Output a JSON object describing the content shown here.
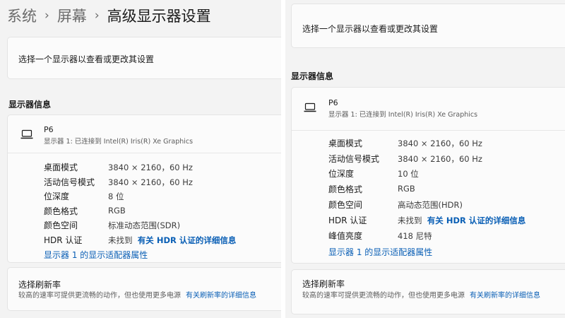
{
  "left_panel": {
    "breadcrumb": {
      "item1": "系统",
      "item2": "屏幕",
      "current": "高级显示器设置",
      "separator": "›"
    },
    "select_display": {
      "text": "选择一个显示器以查看或更改其设置"
    },
    "section_title": "显示器信息",
    "monitor": {
      "name": "P6",
      "subtitle": "显示器 1: 已连接到 Intel(R) Iris(R) Xe Graphics",
      "icon": "laptop-icon"
    },
    "properties": [
      {
        "label": "桌面模式",
        "value": "3840 × 2160，60 Hz"
      },
      {
        "label": "活动信号模式",
        "value": "3840 × 2160，60 Hz"
      },
      {
        "label": "位深度",
        "value": "8 位"
      },
      {
        "label": "颜色格式",
        "value": "RGB"
      },
      {
        "label": "颜色空间",
        "value": "标准动态范围(SDR)"
      }
    ],
    "hdr": {
      "label": "HDR 认证",
      "not_found": "未找到",
      "link": "有关 HDR 认证的详细信息"
    },
    "adapter_link": "显示器 1 的显示适配器属性",
    "refresh": {
      "title": "选择刷新率",
      "desc": "较高的速率可提供更流畅的动作，但也使用更多电源",
      "link": "有关刷新率的详细信息"
    }
  },
  "right_panel": {
    "select_display": {
      "text": "选择一个显示器以查看或更改其设置"
    },
    "section_title": "显示器信息",
    "monitor": {
      "name": "P6",
      "subtitle": "显示器 1: 已连接到 Intel(R) Iris(R) Xe Graphics",
      "icon": "laptop-icon"
    },
    "properties": [
      {
        "label": "桌面模式",
        "value": "3840 × 2160，60 Hz"
      },
      {
        "label": "活动信号模式",
        "value": "3840 × 2160，60 Hz"
      },
      {
        "label": "位深度",
        "value": "10 位"
      },
      {
        "label": "颜色格式",
        "value": "RGB"
      },
      {
        "label": "颜色空间",
        "value": "高动态范围(HDR)"
      }
    ],
    "hdr": {
      "label": "HDR 认证",
      "not_found": "未找到",
      "link": "有关 HDR 认证的详细信息"
    },
    "peak_brightness": {
      "label": "峰值亮度",
      "value": "418 尼特"
    },
    "adapter_link": "显示器 1 的显示适配器属性",
    "refresh": {
      "title": "选择刷新率",
      "desc": "较高的速率可提供更流畅的动作，但也使用更多电源",
      "link": "有关刷新率的详细信息"
    }
  },
  "colors": {
    "link": "#0a5fb5",
    "card_background": "#fbfbfb",
    "page_background": "#f3f3f3"
  }
}
